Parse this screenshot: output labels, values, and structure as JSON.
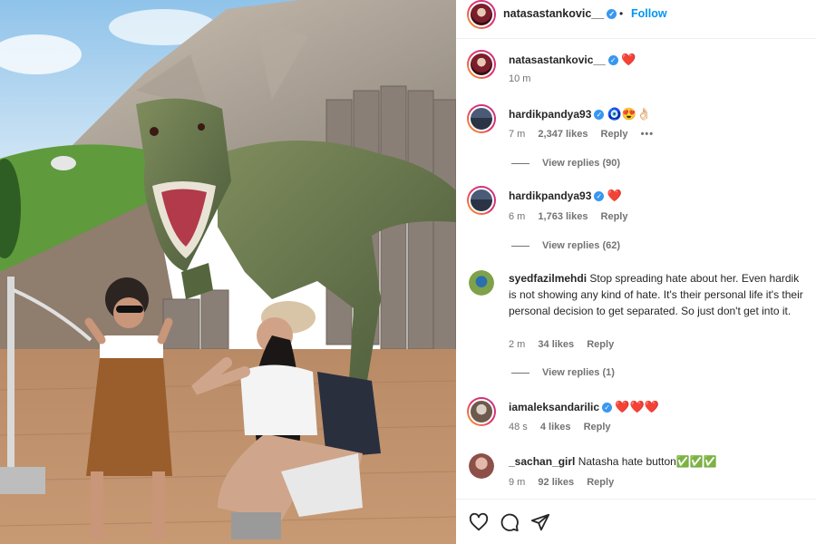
{
  "post": {
    "username": "natasastankovic__",
    "follow_label": "Follow",
    "separator": "•"
  },
  "caption": {
    "username": "natasastankovic__",
    "emoji": "❤️",
    "time": "10 m"
  },
  "comments": [
    {
      "username": "hardikpandya93",
      "text": "🧿😍👌🏻",
      "time": "7 m",
      "likes": "2,347 likes",
      "reply": "Reply",
      "more": "•••",
      "view_replies": "View replies (90)"
    },
    {
      "username": "hardikpandya93",
      "text": "❤️",
      "time": "6 m",
      "likes": "1,763 likes",
      "reply": "Reply",
      "view_replies": "View replies (62)"
    },
    {
      "username": "syedfazilmehdi",
      "text": "Stop spreading hate about her. Even hardik is not showing any kind of hate. It's their personal life it's their personal decision to get separated. So just don't get into it.",
      "time": "2 m",
      "likes": "34 likes",
      "reply": "Reply",
      "view_replies": "View replies (1)"
    },
    {
      "username": "iamaleksandarilic",
      "text": "❤️❤️❤️",
      "time": "48 s",
      "likes": "4 likes",
      "reply": "Reply"
    },
    {
      "username": "_sachan_girl",
      "text": "Natasha hate button✅✅✅",
      "time": "9 m",
      "likes": "92 likes",
      "reply": "Reply"
    }
  ],
  "actions": {
    "icons": [
      "heart-icon",
      "comment-icon",
      "share-icon"
    ]
  },
  "colors": {
    "link_blue": "#0095f6",
    "verified_blue": "#3897f0",
    "secondary_text": "#737373"
  }
}
